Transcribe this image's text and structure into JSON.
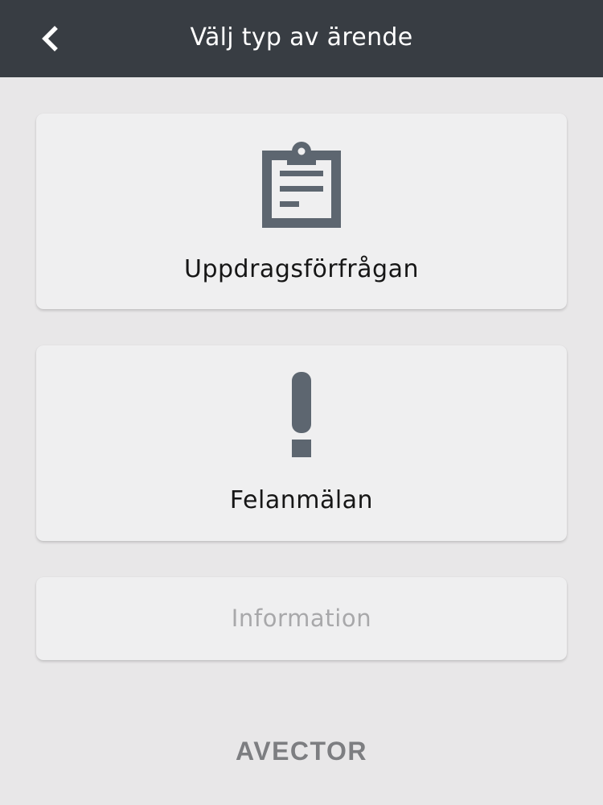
{
  "header": {
    "title": "Välj typ av ärende",
    "back_icon": "chevron-left-icon"
  },
  "options": [
    {
      "label": "Uppdragsförfrågan",
      "icon": "clipboard-icon"
    },
    {
      "label": "Felanmälan",
      "icon": "exclamation-icon"
    },
    {
      "label": "Information"
    }
  ],
  "footer": {
    "logo_text": "AVECTOR"
  },
  "colors": {
    "header_background": "#383d43",
    "page_background": "#e8e7e8",
    "card_background": "#efeff0",
    "icon": "#5d6670",
    "text_primary": "#161616",
    "text_muted": "#a8a8aa",
    "logo": "#7d7e81"
  }
}
